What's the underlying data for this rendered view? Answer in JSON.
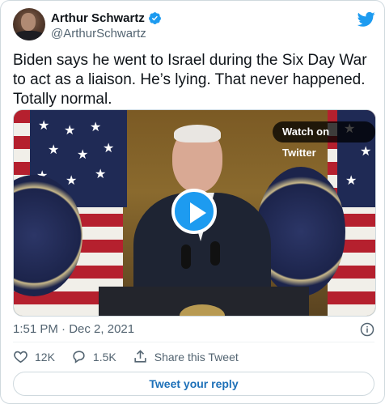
{
  "author": {
    "name": "Arthur Schwartz",
    "handle": "@ArthurSchwartz"
  },
  "tweet": {
    "text": "Biden says he went to Israel during the Six Day War to act as a liaison. He’s lying. That never happened. Totally normal."
  },
  "media": {
    "watch_label": "Watch on Twitter"
  },
  "meta": {
    "time": "1:51 PM",
    "separator": " · ",
    "date": "Dec 2, 2021"
  },
  "actions": {
    "likes": "12K",
    "replies": "1.5K",
    "share_label": "Share this Tweet"
  },
  "reply_button": {
    "label": "Tweet your reply"
  },
  "colors": {
    "accent": "#1d9bf0",
    "verified": "#1d9bf0",
    "secondary_text": "#536471",
    "reply_link": "#1d70b8"
  }
}
